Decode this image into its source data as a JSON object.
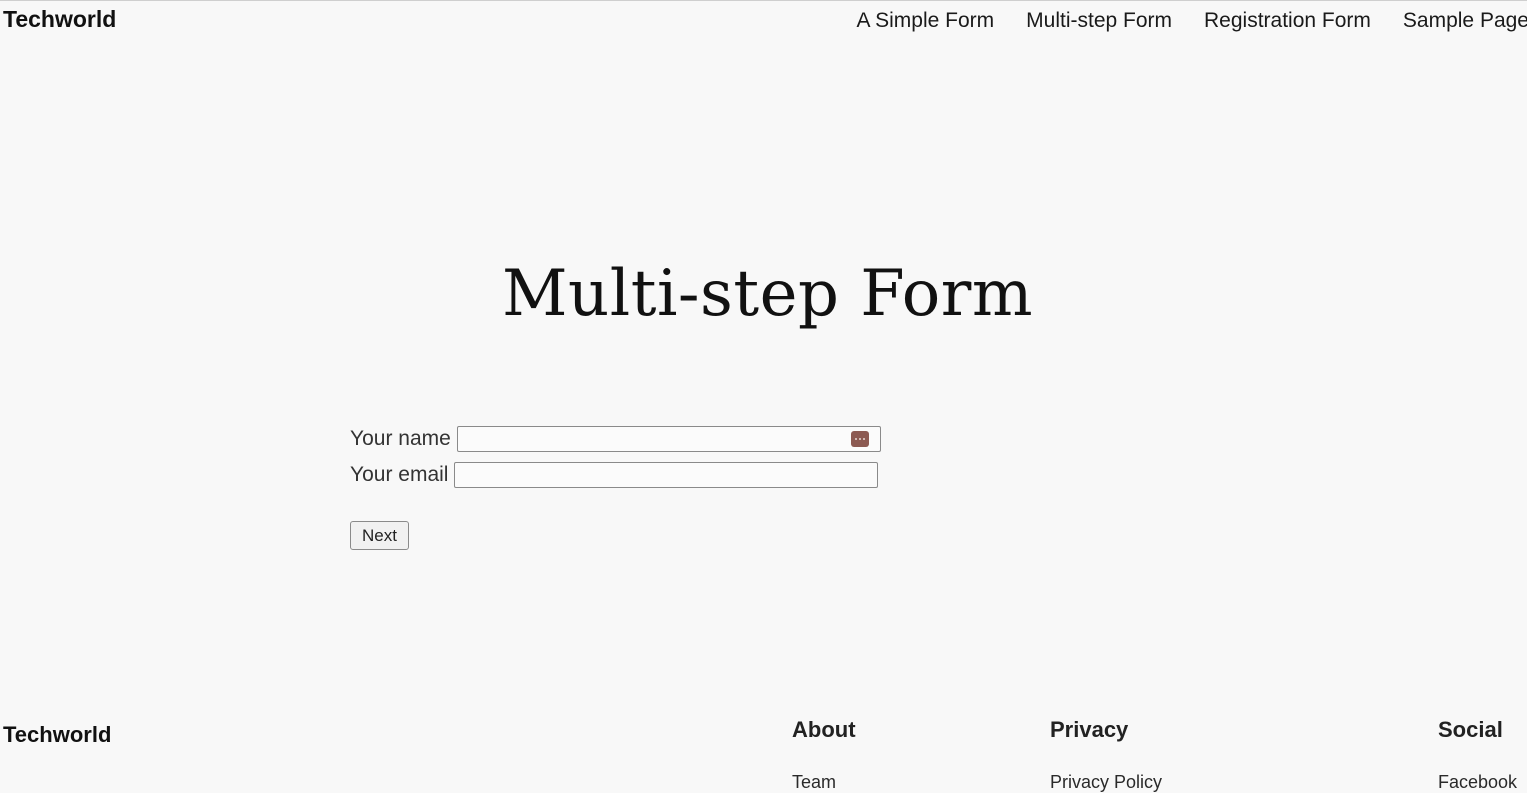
{
  "header": {
    "site_title": "Techworld",
    "nav": [
      {
        "label": "A Simple Form"
      },
      {
        "label": "Multi-step Form"
      },
      {
        "label": "Registration Form"
      },
      {
        "label": "Sample Page"
      }
    ]
  },
  "main": {
    "page_title": "Multi-step Form",
    "form": {
      "name_label": "Your name",
      "name_value": "",
      "email_label": "Your email",
      "email_value": "",
      "next_label": "Next",
      "autofill_icon": "password-manager-icon",
      "autofill_color": "#8c5a52"
    }
  },
  "footer": {
    "site_title": "Techworld",
    "columns": [
      {
        "heading": "About",
        "links": [
          {
            "label": "Team"
          }
        ]
      },
      {
        "heading": "Privacy",
        "links": [
          {
            "label": "Privacy Policy"
          }
        ]
      },
      {
        "heading": "Social",
        "links": [
          {
            "label": "Facebook"
          }
        ]
      }
    ]
  }
}
